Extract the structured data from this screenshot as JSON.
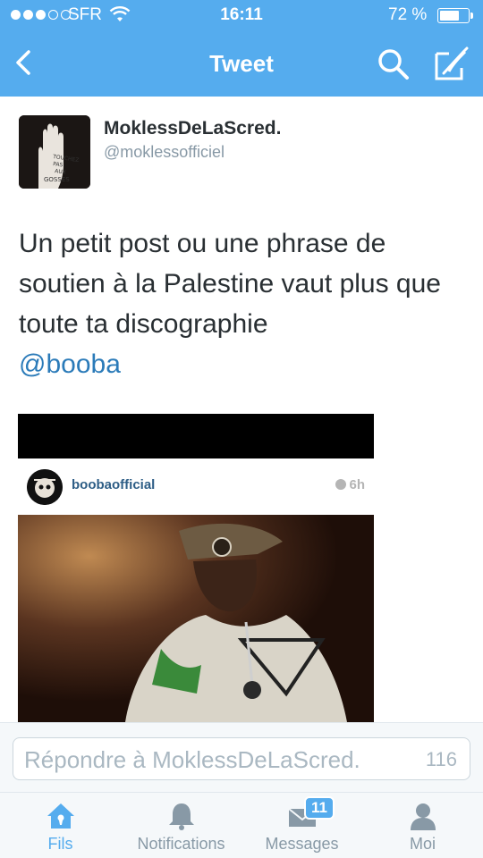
{
  "status_bar": {
    "carrier": "SFR",
    "time": "16:11",
    "battery_percent": "72 %",
    "battery_level": 0.72,
    "signal_bars": 3,
    "signal_total": 5
  },
  "nav": {
    "title": "Tweet",
    "back_icon": "chevron-left-icon",
    "search_icon": "search-icon",
    "compose_icon": "compose-icon"
  },
  "tweet": {
    "author_name": "MoklessDeLaScred.",
    "author_handle": "@moklessofficiel",
    "text": "Un petit post ou une phrase de soutien à la Palestine vaut plus que toute ta discographie",
    "mention": "@booba",
    "avatar_text": [
      "TOUCHEZ",
      "PAS",
      "AUX",
      "GOSSES"
    ]
  },
  "embedded_post": {
    "username": "boobaofficial",
    "time": "6h"
  },
  "reply": {
    "placeholder": "Répondre à MoklessDeLaScred.",
    "char_count": "116"
  },
  "tabs": [
    {
      "label": "Fils",
      "icon": "home-icon",
      "active": true
    },
    {
      "label": "Notifications",
      "icon": "bell-icon",
      "active": false
    },
    {
      "label": "Messages",
      "icon": "messages-icon",
      "active": false,
      "badge": "11"
    },
    {
      "label": "Moi",
      "icon": "person-icon",
      "active": false
    }
  ],
  "colors": {
    "brand": "#55acee",
    "link": "#2b7bb9",
    "inactive": "#8899a6"
  }
}
